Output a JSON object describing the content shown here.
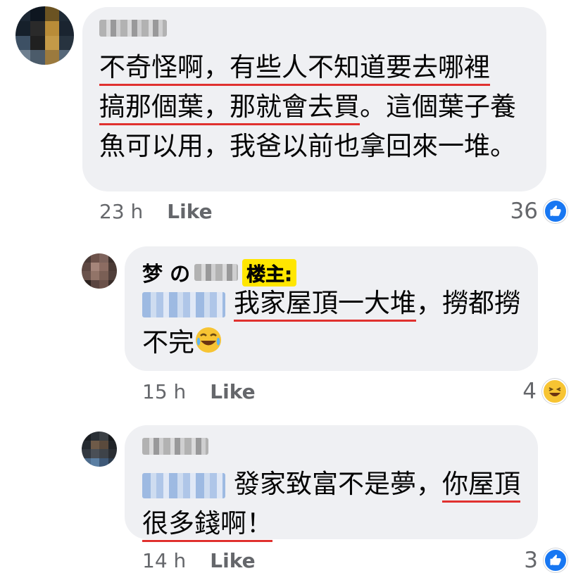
{
  "comments": [
    {
      "author_suffix": "",
      "segments": [
        {
          "text": "不奇怪啊，有些人不知道要去哪裡",
          "underline": true
        },
        {
          "text": "搞那個葉，那就會去買",
          "underline": true
        },
        {
          "text": "。這個葉子養魚可以用，我爸以前也拿回來一堆。",
          "underline": false
        }
      ],
      "time": "23 h",
      "like_label": "Like",
      "reaction_count": "36",
      "reaction_icon": "like-icon"
    },
    {
      "author_prefix": "梦 の",
      "op_tag": "楼主:",
      "segments": [
        {
          "text": "我家屋頂一大堆",
          "underline": true
        },
        {
          "text": "，撈都撈不完",
          "underline": false
        }
      ],
      "emoji": "face-with-tears-of-joy",
      "time": "15 h",
      "like_label": "Like",
      "reaction_count": "4",
      "reaction_icon": "haha-icon"
    },
    {
      "segments": [
        {
          "text": "發家致富不是夢，",
          "underline": false
        },
        {
          "text": "你屋頂很多錢啊！",
          "underline": true
        }
      ],
      "time": "14 h",
      "like_label": "Like",
      "reaction_count": "3",
      "reaction_icon": "like-icon"
    }
  ]
}
